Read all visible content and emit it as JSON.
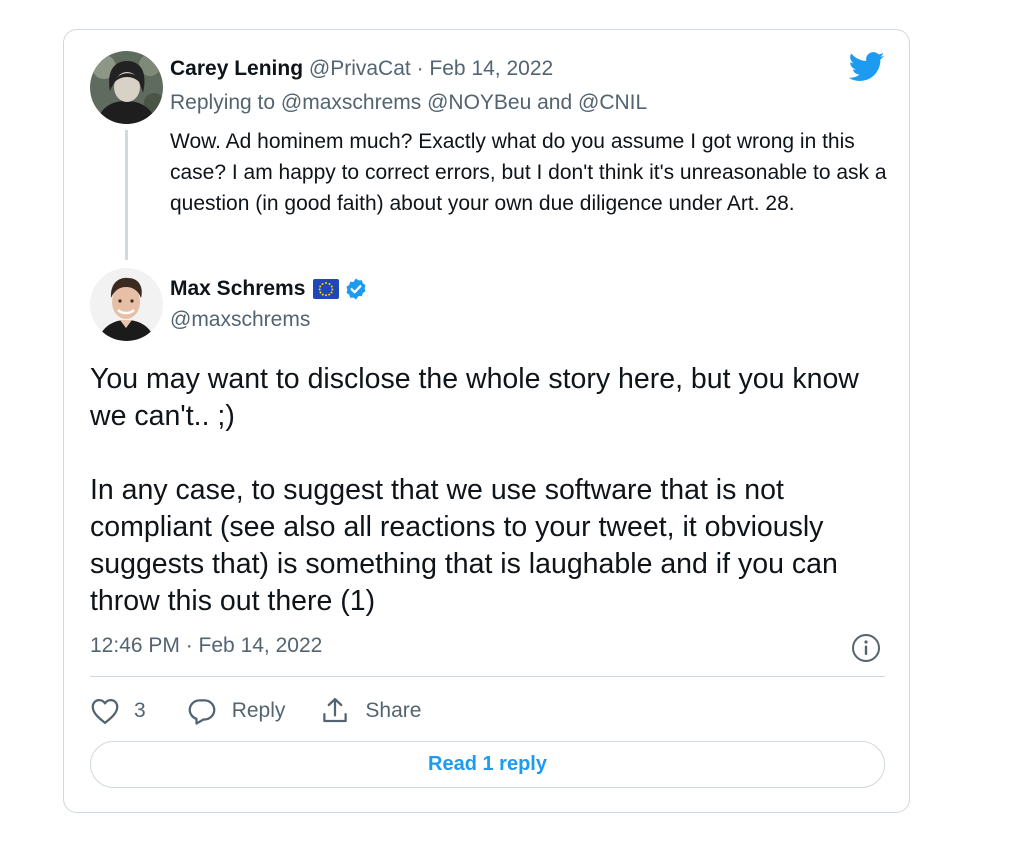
{
  "reply_tweet": {
    "author_name": "Carey Lening",
    "author_handle": "@PrivaCat",
    "separator": "·",
    "date": "Feb 14, 2022",
    "replying_prefix": "Replying to ",
    "replying_handles": [
      "@maxschrems",
      "@NOYBeu",
      "@CNIL"
    ],
    "replying_conjunction": " and ",
    "text": "Wow. Ad hominem much? Exactly what do you assume I got wrong in this case? I am happy to correct errors, but I don't think it's unreasonable to ask a question (in good faith) about your own due diligence under Art. 28."
  },
  "main_tweet": {
    "author_name": "Max Schrems",
    "author_handle": "@maxschrems",
    "flag_icon": "eu-flag-icon",
    "verified_icon": "verified-badge-icon",
    "text": "You may want to disclose the whole story here, but you know we can't.. ;)\n\nIn any case, to suggest that we use software that is not compliant (see also all reactions to your tweet, it obviously suggests that) is something that is laughable and if you can throw this out there (1)",
    "timestamp": "12:46 PM · Feb 14, 2022"
  },
  "actions": {
    "like_count": "3",
    "reply_label": "Reply",
    "share_label": "Share"
  },
  "read_reply_label": "Read 1 reply",
  "colors": {
    "accent": "#1d9bf0",
    "text": "#0f1419",
    "secondary": "#536471",
    "border": "#cfd9de"
  }
}
